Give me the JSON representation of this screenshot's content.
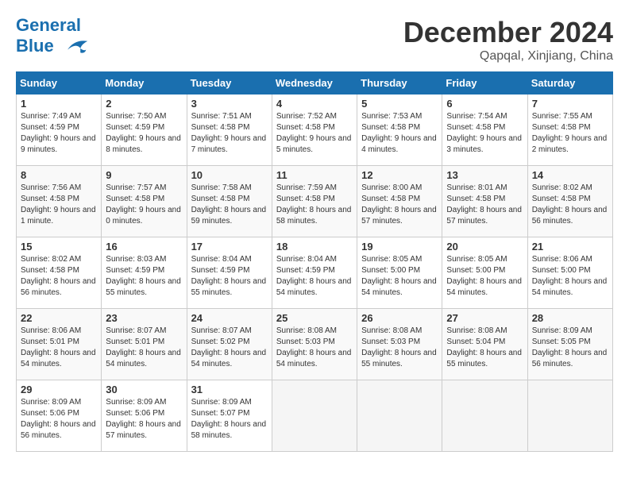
{
  "header": {
    "logo_line1": "General",
    "logo_line2": "Blue",
    "month": "December 2024",
    "location": "Qapqal, Xinjiang, China"
  },
  "days_of_week": [
    "Sunday",
    "Monday",
    "Tuesday",
    "Wednesday",
    "Thursday",
    "Friday",
    "Saturday"
  ],
  "weeks": [
    [
      {
        "num": "1",
        "rise": "7:49 AM",
        "set": "4:59 PM",
        "daylight": "9 hours and 9 minutes."
      },
      {
        "num": "2",
        "rise": "7:50 AM",
        "set": "4:59 PM",
        "daylight": "9 hours and 8 minutes."
      },
      {
        "num": "3",
        "rise": "7:51 AM",
        "set": "4:58 PM",
        "daylight": "9 hours and 7 minutes."
      },
      {
        "num": "4",
        "rise": "7:52 AM",
        "set": "4:58 PM",
        "daylight": "9 hours and 5 minutes."
      },
      {
        "num": "5",
        "rise": "7:53 AM",
        "set": "4:58 PM",
        "daylight": "9 hours and 4 minutes."
      },
      {
        "num": "6",
        "rise": "7:54 AM",
        "set": "4:58 PM",
        "daylight": "9 hours and 3 minutes."
      },
      {
        "num": "7",
        "rise": "7:55 AM",
        "set": "4:58 PM",
        "daylight": "9 hours and 2 minutes."
      }
    ],
    [
      {
        "num": "8",
        "rise": "7:56 AM",
        "set": "4:58 PM",
        "daylight": "9 hours and 1 minute."
      },
      {
        "num": "9",
        "rise": "7:57 AM",
        "set": "4:58 PM",
        "daylight": "9 hours and 0 minutes."
      },
      {
        "num": "10",
        "rise": "7:58 AM",
        "set": "4:58 PM",
        "daylight": "8 hours and 59 minutes."
      },
      {
        "num": "11",
        "rise": "7:59 AM",
        "set": "4:58 PM",
        "daylight": "8 hours and 58 minutes."
      },
      {
        "num": "12",
        "rise": "8:00 AM",
        "set": "4:58 PM",
        "daylight": "8 hours and 57 minutes."
      },
      {
        "num": "13",
        "rise": "8:01 AM",
        "set": "4:58 PM",
        "daylight": "8 hours and 57 minutes."
      },
      {
        "num": "14",
        "rise": "8:02 AM",
        "set": "4:58 PM",
        "daylight": "8 hours and 56 minutes."
      }
    ],
    [
      {
        "num": "15",
        "rise": "8:02 AM",
        "set": "4:58 PM",
        "daylight": "8 hours and 56 minutes."
      },
      {
        "num": "16",
        "rise": "8:03 AM",
        "set": "4:59 PM",
        "daylight": "8 hours and 55 minutes."
      },
      {
        "num": "17",
        "rise": "8:04 AM",
        "set": "4:59 PM",
        "daylight": "8 hours and 55 minutes."
      },
      {
        "num": "18",
        "rise": "8:04 AM",
        "set": "4:59 PM",
        "daylight": "8 hours and 54 minutes."
      },
      {
        "num": "19",
        "rise": "8:05 AM",
        "set": "5:00 PM",
        "daylight": "8 hours and 54 minutes."
      },
      {
        "num": "20",
        "rise": "8:05 AM",
        "set": "5:00 PM",
        "daylight": "8 hours and 54 minutes."
      },
      {
        "num": "21",
        "rise": "8:06 AM",
        "set": "5:00 PM",
        "daylight": "8 hours and 54 minutes."
      }
    ],
    [
      {
        "num": "22",
        "rise": "8:06 AM",
        "set": "5:01 PM",
        "daylight": "8 hours and 54 minutes."
      },
      {
        "num": "23",
        "rise": "8:07 AM",
        "set": "5:01 PM",
        "daylight": "8 hours and 54 minutes."
      },
      {
        "num": "24",
        "rise": "8:07 AM",
        "set": "5:02 PM",
        "daylight": "8 hours and 54 minutes."
      },
      {
        "num": "25",
        "rise": "8:08 AM",
        "set": "5:03 PM",
        "daylight": "8 hours and 54 minutes."
      },
      {
        "num": "26",
        "rise": "8:08 AM",
        "set": "5:03 PM",
        "daylight": "8 hours and 55 minutes."
      },
      {
        "num": "27",
        "rise": "8:08 AM",
        "set": "5:04 PM",
        "daylight": "8 hours and 55 minutes."
      },
      {
        "num": "28",
        "rise": "8:09 AM",
        "set": "5:05 PM",
        "daylight": "8 hours and 56 minutes."
      }
    ],
    [
      {
        "num": "29",
        "rise": "8:09 AM",
        "set": "5:06 PM",
        "daylight": "8 hours and 56 minutes."
      },
      {
        "num": "30",
        "rise": "8:09 AM",
        "set": "5:06 PM",
        "daylight": "8 hours and 57 minutes."
      },
      {
        "num": "31",
        "rise": "8:09 AM",
        "set": "5:07 PM",
        "daylight": "8 hours and 58 minutes."
      },
      null,
      null,
      null,
      null
    ]
  ]
}
